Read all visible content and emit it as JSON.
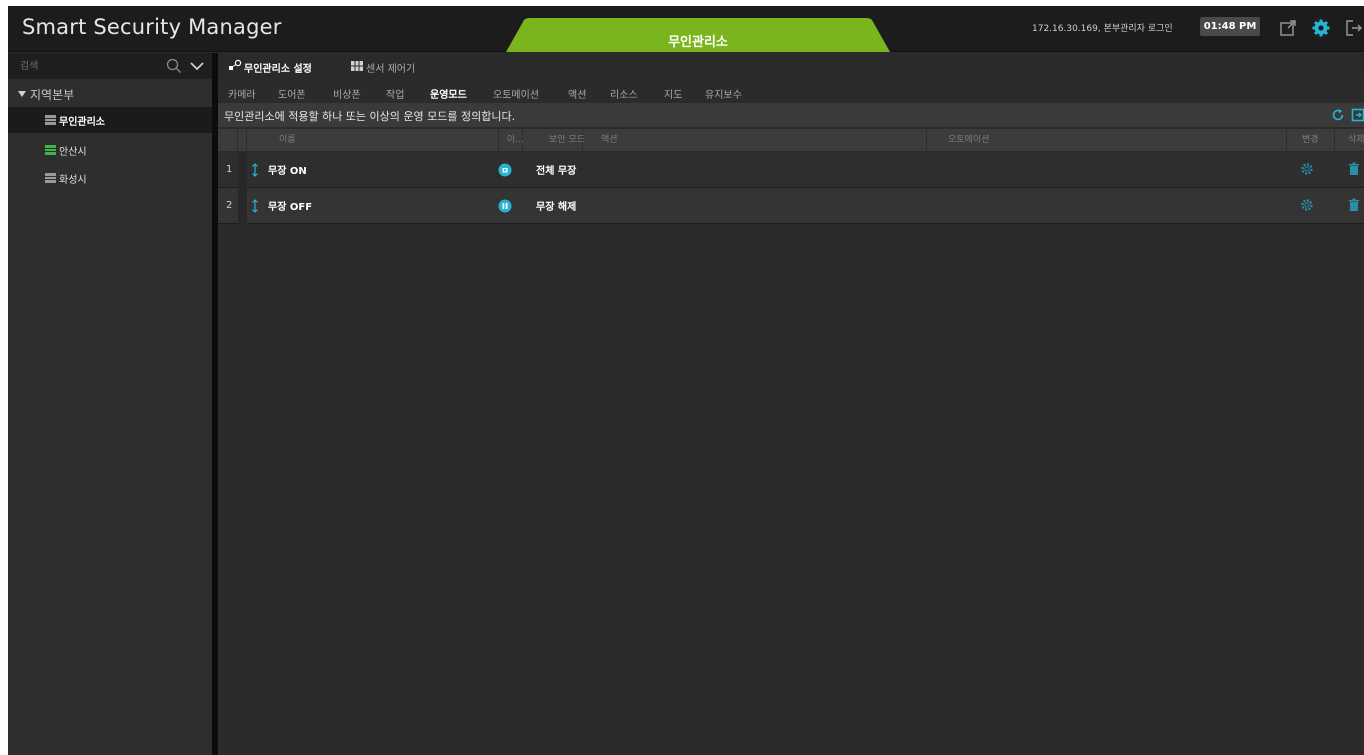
{
  "header": {
    "app_title": "Smart Security Manager",
    "center_tab": "무인관리소",
    "login_info": "172.16.30.169, 본부관리자 로그인",
    "time": "01:48 PM",
    "icons": [
      "window-icon",
      "settings-gear-icon",
      "logout-icon"
    ],
    "accent_color": "#7ab51d"
  },
  "sidebar": {
    "search_placeholder": "검색",
    "root": "지역본부",
    "items": [
      {
        "label": "무인관리소",
        "selected": true,
        "icon_color": "#9a9a9a"
      },
      {
        "label": "안산시",
        "selected": false,
        "icon_color": "#3fb64a"
      },
      {
        "label": "화성시",
        "selected": false,
        "icon_color": "#9a9a9a"
      }
    ]
  },
  "main": {
    "top_tabs": [
      {
        "label": "무인관리소 설정",
        "active": true
      },
      {
        "label": "센서 제어기",
        "active": false
      }
    ],
    "sub_tabs": [
      "카메라",
      "도어폰",
      "비상폰",
      "작업",
      "운영모드",
      "오토메이션",
      "액션",
      "리소스",
      "지도",
      "유지보수"
    ],
    "active_sub_tab": "운영모드",
    "description": "무인관리소에 적용할 하나 또는 이상의 운영 모드를 정의합니다.",
    "table": {
      "columns": [
        "이름",
        "아...",
        "보안 모드",
        "액션",
        "오토메이션",
        "변경",
        "삭제"
      ],
      "rows": [
        {
          "index": "1",
          "name": "무장 ON",
          "security_mode": "전체 무장",
          "mode_icon": "arm-full-icon"
        },
        {
          "index": "2",
          "name": "무장 OFF",
          "security_mode": "무장 해제",
          "mode_icon": "disarm-icon"
        }
      ]
    }
  }
}
